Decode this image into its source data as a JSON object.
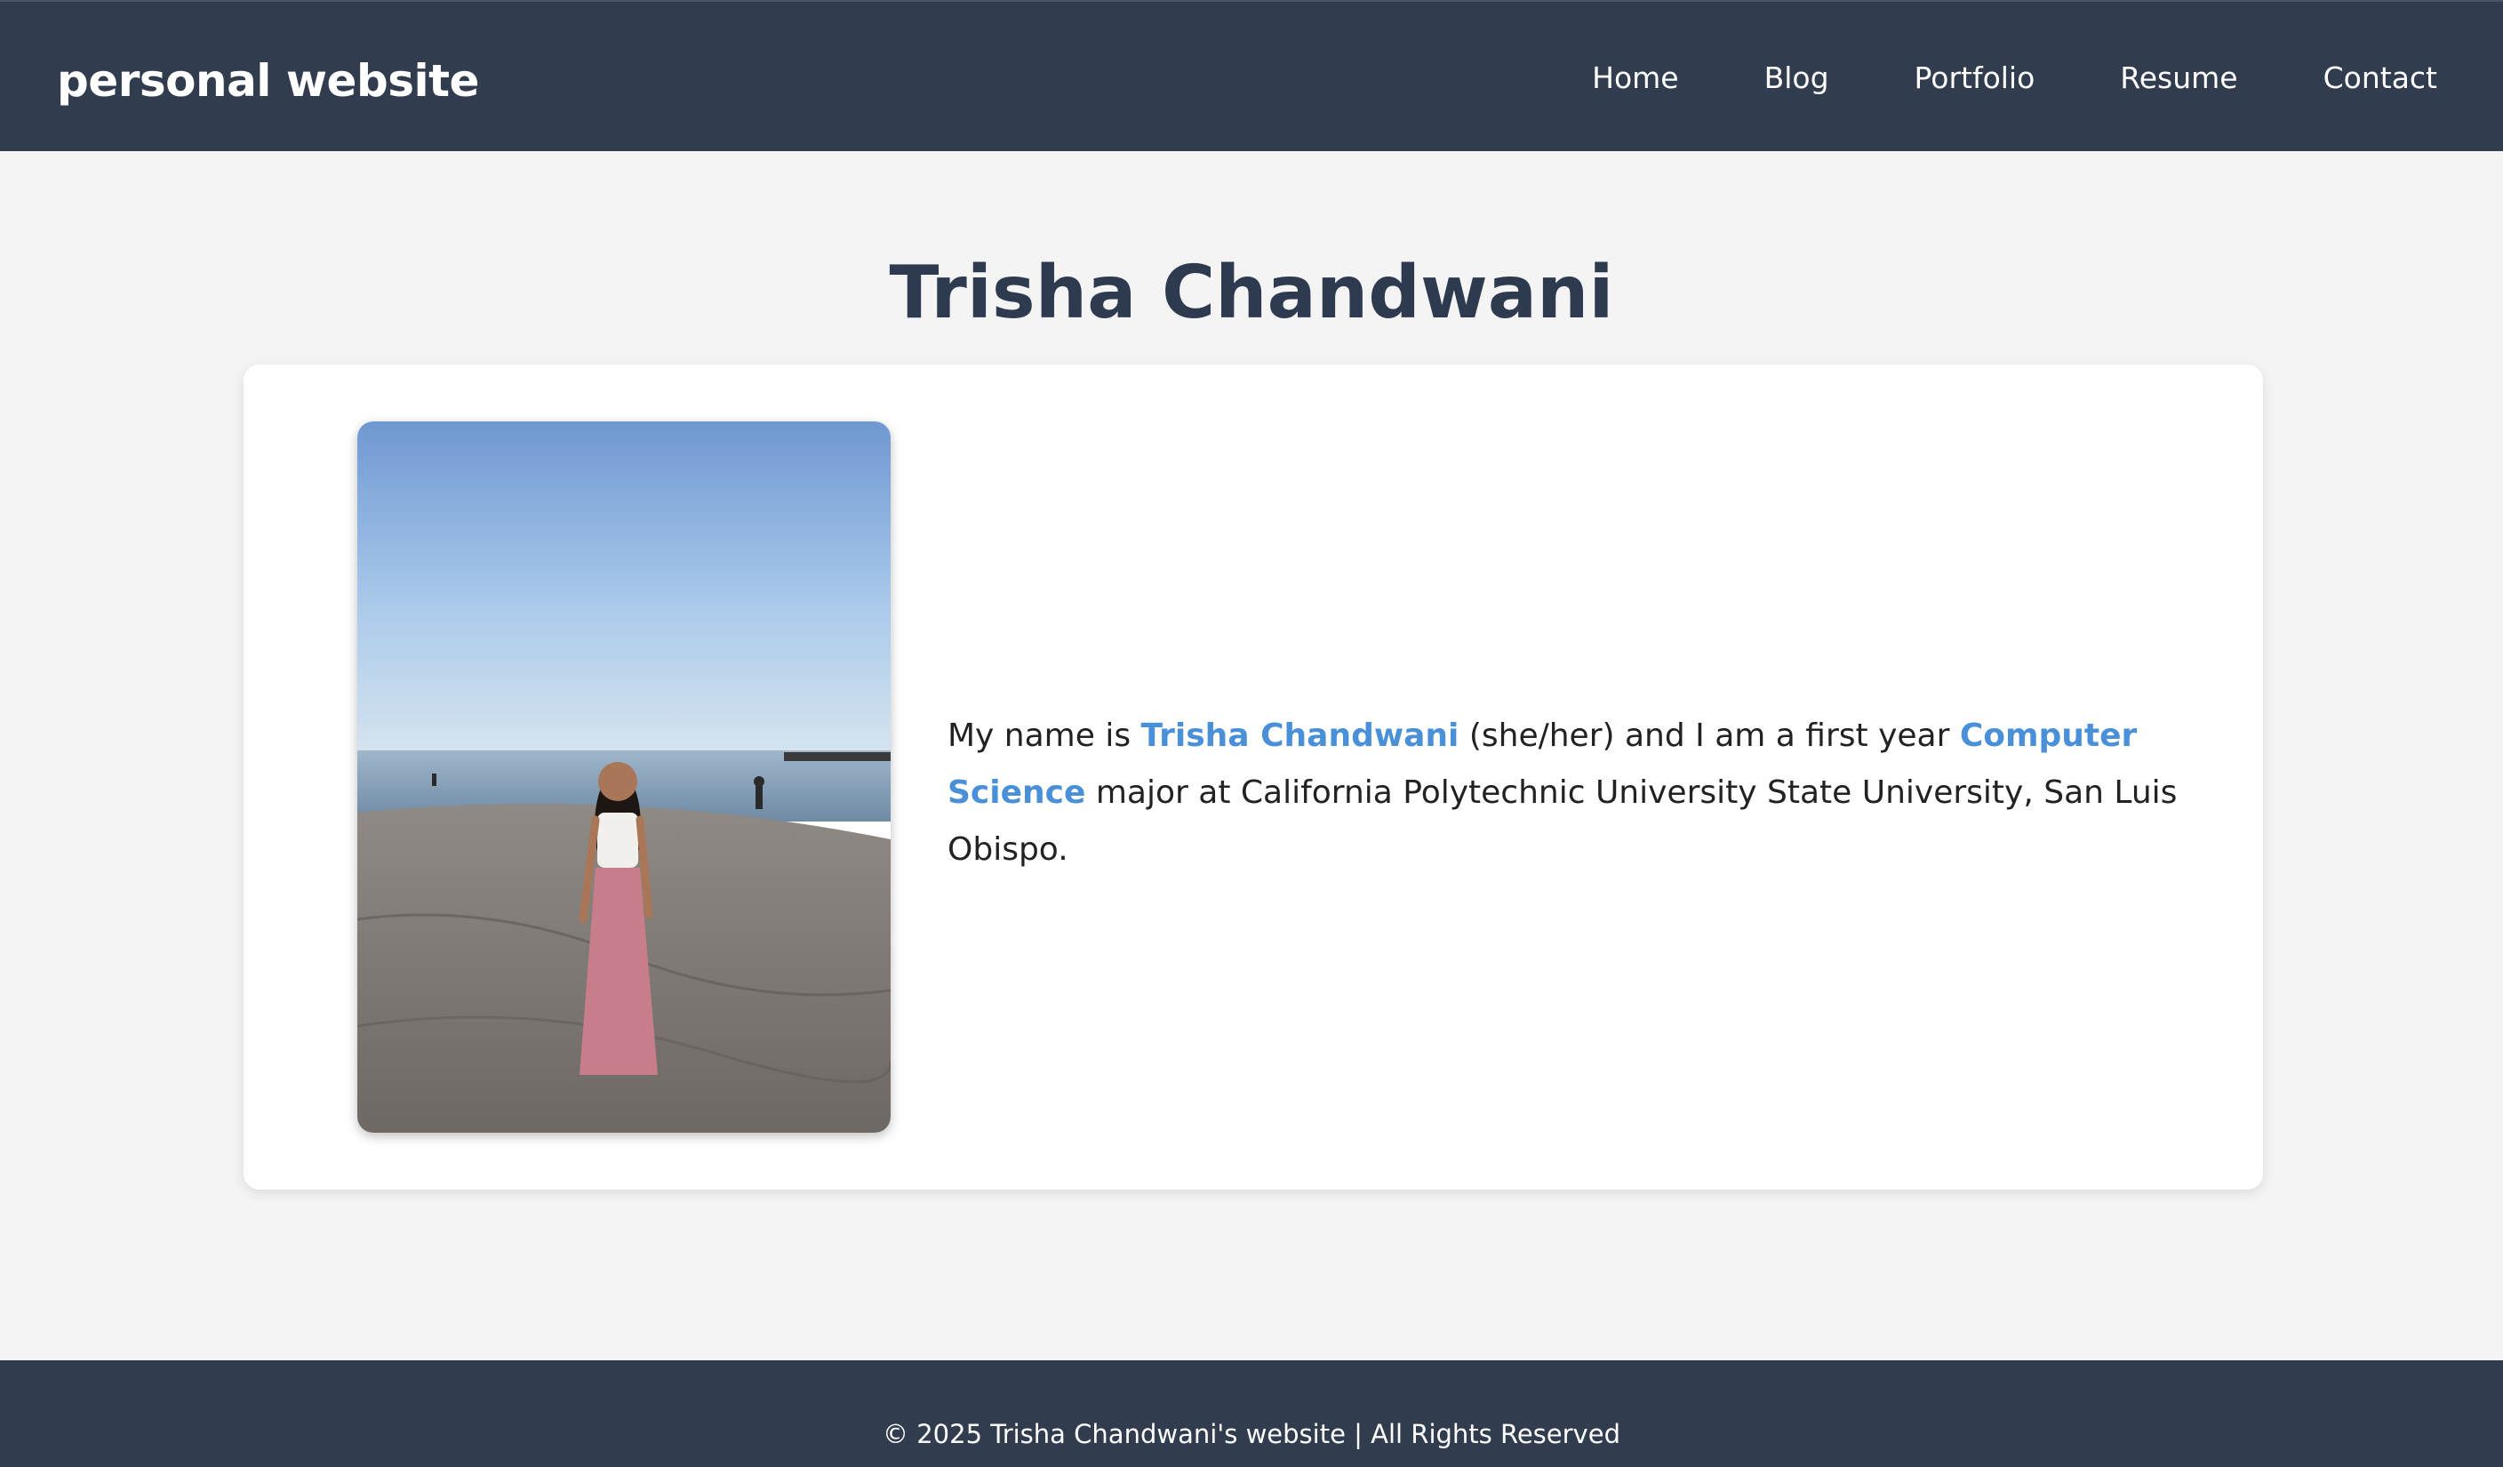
{
  "header": {
    "brand": "personal website",
    "nav": [
      {
        "label": "Home"
      },
      {
        "label": "Blog"
      },
      {
        "label": "Portfolio"
      },
      {
        "label": "Resume"
      },
      {
        "label": "Contact"
      }
    ]
  },
  "main": {
    "title": "Trisha Chandwani",
    "bio": {
      "part1": "My name is ",
      "name": "Trisha Chandwani",
      "part2": " (she/her) and I am a first year ",
      "major": "Computer Science",
      "part3": " major at California Polytechnic University State University, San Luis Obispo."
    }
  },
  "footer": {
    "text": "© 2025 Trisha Chandwani's website | All Rights Reserved"
  },
  "colors": {
    "navbar": "#313d4f",
    "title": "#2d3a4f",
    "accent": "#4a90d9",
    "background": "#f4f4f4"
  }
}
